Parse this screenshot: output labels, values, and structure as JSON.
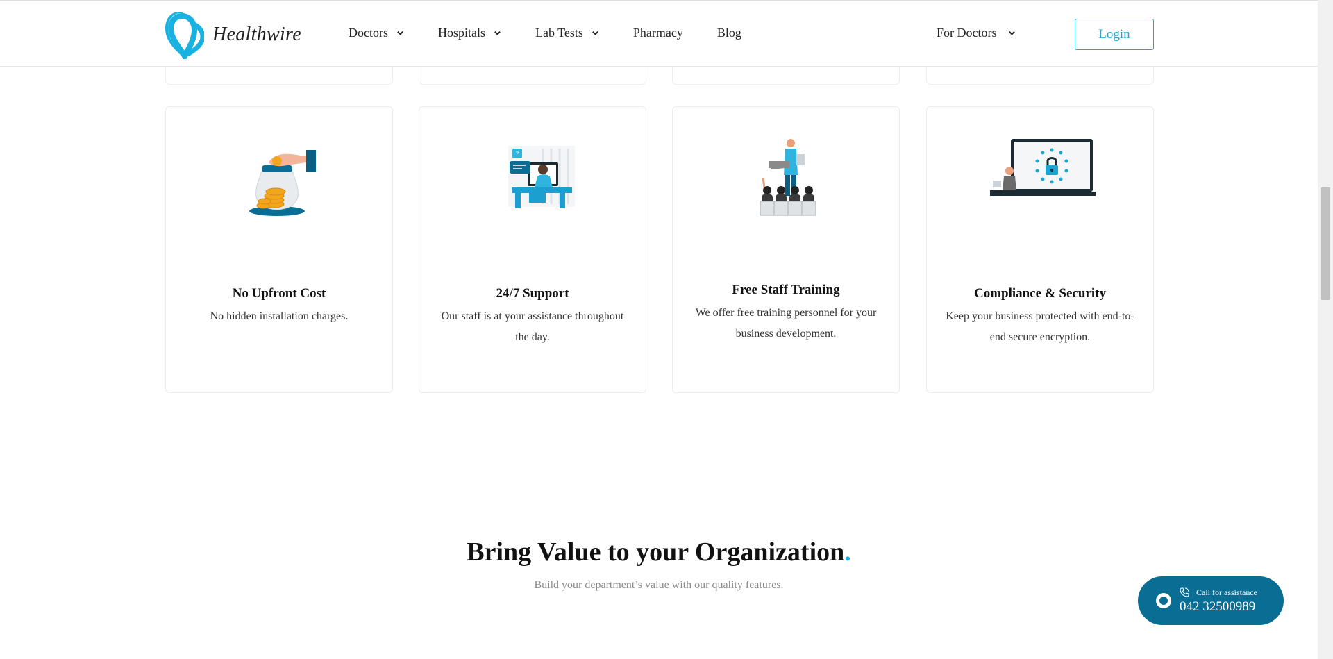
{
  "header": {
    "logo_text": "Healthwire",
    "nav": [
      {
        "label": "Doctors",
        "has_dropdown": true
      },
      {
        "label": "Hospitals",
        "has_dropdown": true
      },
      {
        "label": "Lab Tests",
        "has_dropdown": true
      },
      {
        "label": "Pharmacy",
        "has_dropdown": false
      },
      {
        "label": "Blog",
        "has_dropdown": false
      }
    ],
    "for_doctors": "For Doctors",
    "login": "Login"
  },
  "cards": [
    {
      "title": "No Upfront Cost",
      "desc": "No hidden installation charges.",
      "icon": "coin-jar-icon"
    },
    {
      "title": "24/7 Support",
      "desc": "Our staff is at your assistance throughout the day.",
      "icon": "support-agent-icon"
    },
    {
      "title": "Free Staff Training",
      "desc": "We offer free training personnel for your business development.",
      "icon": "training-icon"
    },
    {
      "title": "Compliance & Security",
      "desc": "Keep your business protected with end-to-end secure encryption.",
      "icon": "security-lock-icon"
    }
  ],
  "section": {
    "title": "Bring Value to your Organization",
    "title_dot": ".",
    "subtitle": "Build your department’s value with our quality features."
  },
  "call": {
    "label": "Call for assistance",
    "number": "042 32500989"
  },
  "colors": {
    "brand": "#19b2e0",
    "call_bg": "#0a6e94",
    "login_border": "#19a6d4"
  }
}
